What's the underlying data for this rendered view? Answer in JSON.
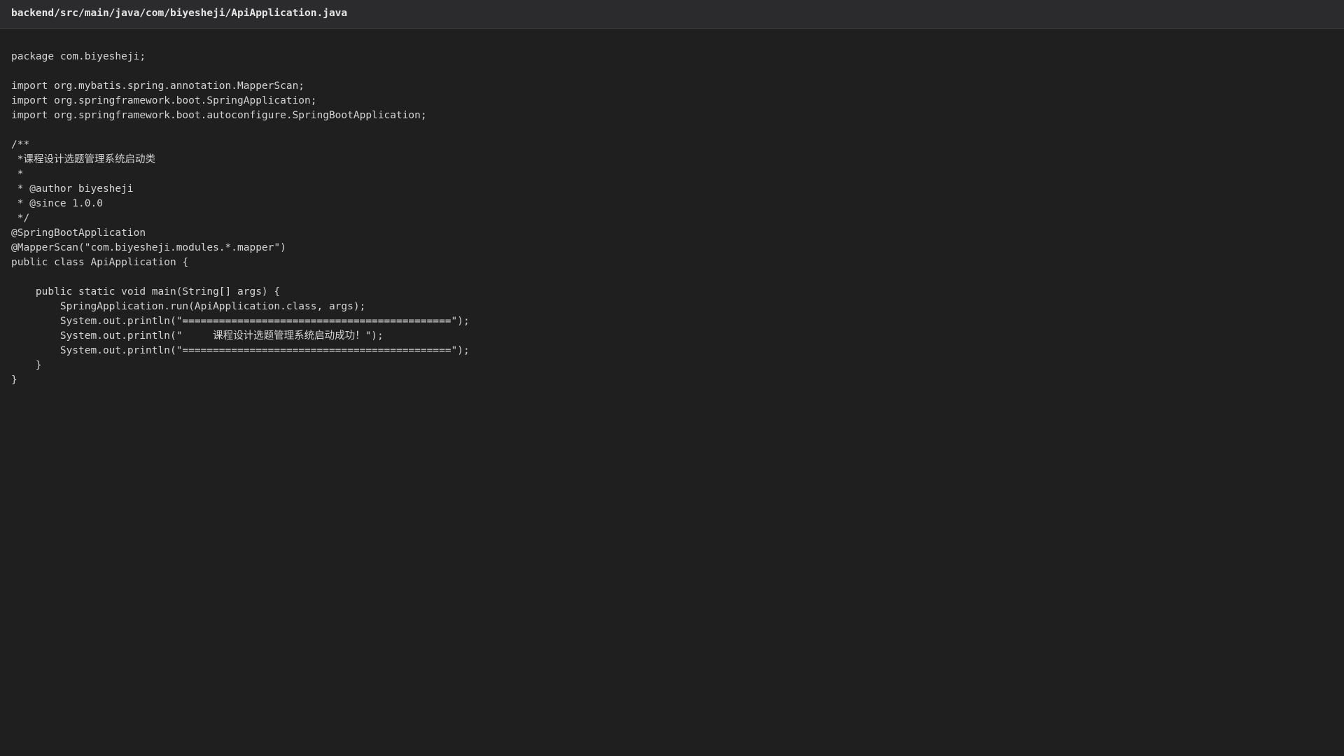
{
  "file": {
    "path": "backend/src/main/java/com/biyesheji/ApiApplication.java"
  },
  "code": {
    "lines": [
      "package com.biyesheji;",
      "",
      "import org.mybatis.spring.annotation.MapperScan;",
      "import org.springframework.boot.SpringApplication;",
      "import org.springframework.boot.autoconfigure.SpringBootApplication;",
      "",
      "/**",
      " *课程设计选题管理系统启动类",
      " *",
      " * @author biyesheji",
      " * @since 1.0.0",
      " */",
      "@SpringBootApplication",
      "@MapperScan(\"com.biyesheji.modules.*.mapper\")",
      "public class ApiApplication {",
      "",
      "    public static void main(String[] args) {",
      "        SpringApplication.run(ApiApplication.class, args);",
      "        System.out.println(\"============================================\");",
      "        System.out.println(\"     课程设计选题管理系统启动成功！\");",
      "        System.out.println(\"============================================\");",
      "    }",
      "}"
    ]
  }
}
